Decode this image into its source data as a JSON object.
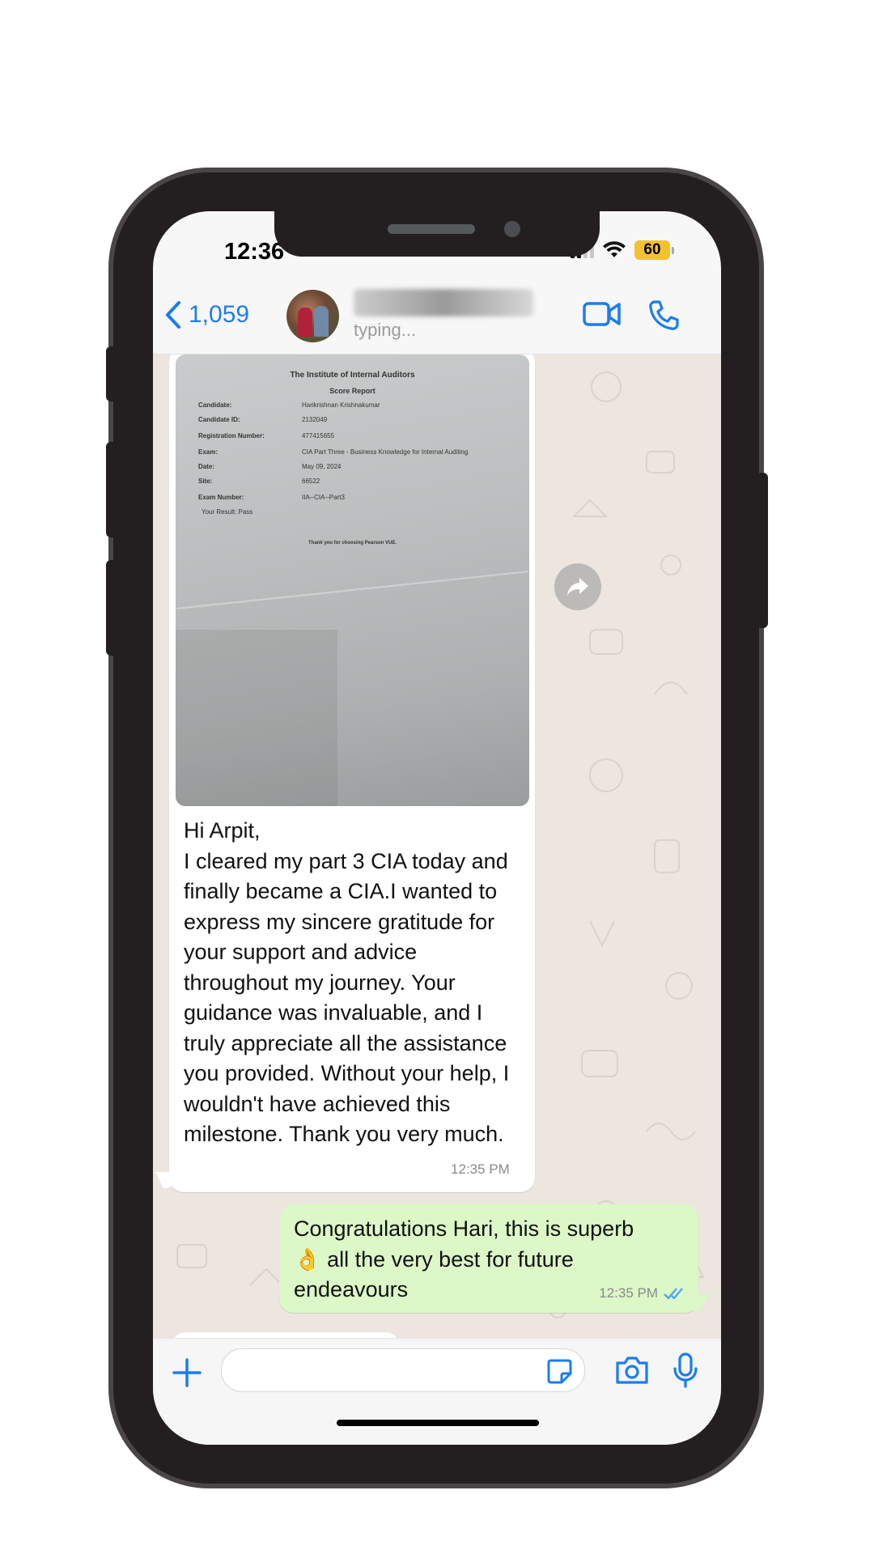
{
  "status_bar": {
    "time": "12:36",
    "battery_level": "60",
    "battery_color": "#f2c230"
  },
  "header": {
    "back_count": "1,059",
    "contact_status": "typing...",
    "accent_color": "#1a7cf3",
    "icons": [
      "chevron-left-icon",
      "video-call-icon",
      "phone-icon"
    ]
  },
  "incoming_message": {
    "attachment_document": {
      "title": "The Institute of Internal Auditors",
      "subtitle": "Score Report",
      "fields": [
        {
          "label": "Candidate:",
          "value": "Harikrishnan Krishnakumar"
        },
        {
          "label": "Candidate ID:",
          "value": "2132049"
        },
        {
          "label": "Registration Number:",
          "value": "477415655"
        },
        {
          "label": "Exam:",
          "value": "CIA Part Three - Business Knowledge for Internal Auditing"
        },
        {
          "label": "Date:",
          "value": "May 09, 2024"
        },
        {
          "label": "Site:",
          "value": "66522"
        },
        {
          "label": "Exam Number:",
          "value": "IIA--CIA--Part3"
        }
      ],
      "result": "Your Result: Pass",
      "footer": "Thank you for choosing Pearson VUE."
    },
    "text": "Hi Arpit,\nI cleared my part 3 CIA today and finally became a CIA.I wanted to express my sincere gratitude for your support and advice throughout my journey. Your guidance was invaluable, and I truly appreciate all the assistance you provided. Without your help, I wouldn't have achieved this milestone. Thank you very much.",
    "time": "12:35 PM"
  },
  "outgoing_message": {
    "text_line1": "Congratulations Hari, this is superb",
    "emoji": "👌",
    "text_rest": " all the very best for future endeavours",
    "time": "12:35 PM",
    "read_receipt_color": "#53a6f0"
  },
  "input_bar": {
    "placeholder": ""
  }
}
